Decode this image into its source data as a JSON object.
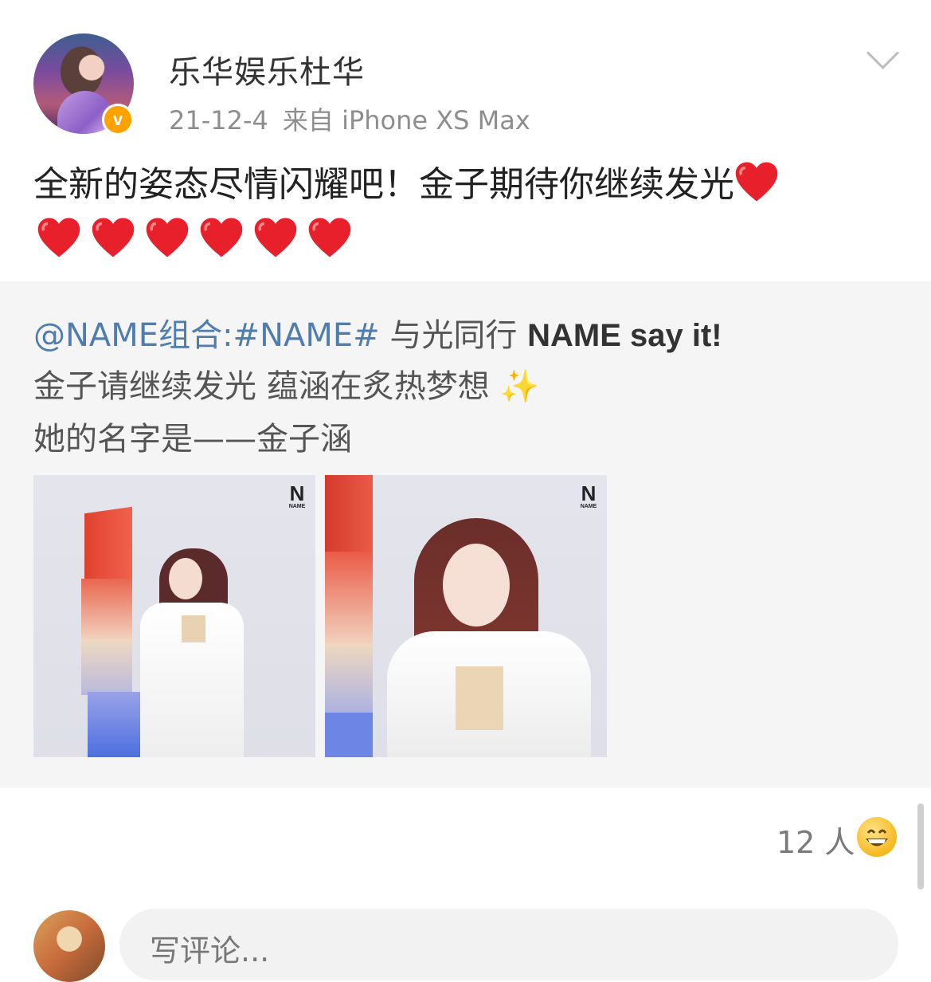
{
  "header": {
    "username": "乐华娱乐杜华",
    "date": "21-12-4",
    "source": "来自 iPhone XS Max",
    "verified_badge": "v"
  },
  "post": {
    "text": "全新的姿态尽情闪耀吧！金子期待你继续发光",
    "heart_count": 7
  },
  "repost": {
    "mention": "@NAME组合:",
    "hashtag": "#NAME#",
    "line1_text": " 与光同行 ",
    "line1_bold": "NAME say it!",
    "line2": "金子请继续发光 蕴涵在炙热梦想",
    "line3": "她的名字是——金子涵",
    "images": [
      {
        "logo_letter": "N",
        "logo_text": "NAME"
      },
      {
        "logo_letter": "N",
        "logo_text": "NAME"
      }
    ]
  },
  "footer": {
    "reactions_count": "12 人",
    "reaction_icon": "grinning-face-icon",
    "comment_placeholder": "写评论..."
  },
  "colors": {
    "mention": "#507daf",
    "badge": "#ffa200",
    "repost_bg": "#f5f5f5",
    "heart": "#e8202b"
  }
}
